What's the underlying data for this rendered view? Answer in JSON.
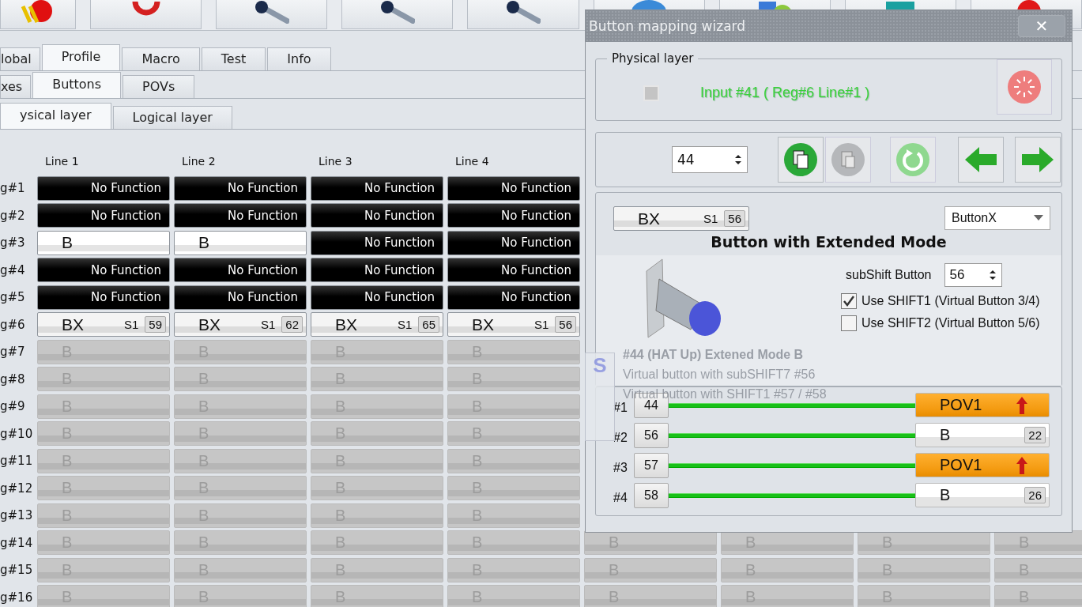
{
  "main_tabs": [
    {
      "label": "lobal",
      "selected": false
    },
    {
      "label": "Profile",
      "selected": true
    },
    {
      "label": "Macro",
      "selected": false
    },
    {
      "label": "Test",
      "selected": false
    },
    {
      "label": "Info",
      "selected": false
    }
  ],
  "sub_tabs": [
    {
      "label": "xes",
      "selected": false
    },
    {
      "label": "Buttons",
      "selected": true
    },
    {
      "label": "POVs",
      "selected": false
    }
  ],
  "layer_tabs": [
    {
      "label": "ysical layer",
      "selected": true
    },
    {
      "label": "Logical layer",
      "selected": false
    }
  ],
  "grid": {
    "columns": [
      "Line 1",
      "Line 2",
      "Line 3",
      "Line 4"
    ],
    "rows": [
      {
        "label": "g#1",
        "cells": [
          {
            "kind": "none",
            "text": "No Function"
          },
          {
            "kind": "none",
            "text": "No Function"
          },
          {
            "kind": "none",
            "text": "No Function"
          },
          {
            "kind": "none",
            "text": "No Function"
          }
        ]
      },
      {
        "label": "g#2",
        "cells": [
          {
            "kind": "none",
            "text": "No Function"
          },
          {
            "kind": "none",
            "text": "No Function"
          },
          {
            "kind": "none",
            "text": "No Function"
          },
          {
            "kind": "none",
            "text": "No Function"
          }
        ]
      },
      {
        "label": "g#3",
        "cells": [
          {
            "kind": "b",
            "text": "B"
          },
          {
            "kind": "b",
            "text": "B"
          },
          {
            "kind": "none",
            "text": "No Function"
          },
          {
            "kind": "none",
            "text": "No Function"
          }
        ]
      },
      {
        "label": "g#4",
        "cells": [
          {
            "kind": "none",
            "text": "No Function"
          },
          {
            "kind": "none",
            "text": "No Function"
          },
          {
            "kind": "none",
            "text": "No Function"
          },
          {
            "kind": "none",
            "text": "No Function"
          }
        ]
      },
      {
        "label": "g#5",
        "cells": [
          {
            "kind": "none",
            "text": "No Function"
          },
          {
            "kind": "none",
            "text": "No Function"
          },
          {
            "kind": "none",
            "text": "No Function"
          },
          {
            "kind": "none",
            "text": "No Function"
          }
        ]
      },
      {
        "label": "g#6",
        "cells": [
          {
            "kind": "bx",
            "text": "BX",
            "shift": "S1",
            "number": "59"
          },
          {
            "kind": "bx",
            "text": "BX",
            "shift": "S1",
            "number": "62"
          },
          {
            "kind": "bx",
            "text": "BX",
            "shift": "S1",
            "number": "65"
          },
          {
            "kind": "bx",
            "text": "BX",
            "shift": "S1",
            "number": "56"
          }
        ]
      },
      {
        "label": "g#7",
        "cells": [
          {
            "kind": "disabled",
            "text": "B"
          },
          {
            "kind": "disabled",
            "text": "B"
          },
          {
            "kind": "disabled",
            "text": "B"
          },
          {
            "kind": "disabled",
            "text": "B"
          }
        ]
      },
      {
        "label": "g#8",
        "cells": [
          {
            "kind": "disabled",
            "text": "B"
          },
          {
            "kind": "disabled",
            "text": "B"
          },
          {
            "kind": "disabled",
            "text": "B"
          },
          {
            "kind": "disabled",
            "text": "B"
          }
        ]
      },
      {
        "label": "g#9",
        "cells": [
          {
            "kind": "disabled",
            "text": "B"
          },
          {
            "kind": "disabled",
            "text": "B"
          },
          {
            "kind": "disabled",
            "text": "B"
          },
          {
            "kind": "disabled",
            "text": "B"
          }
        ]
      },
      {
        "label": "g#10",
        "cells": [
          {
            "kind": "disabled",
            "text": "B"
          },
          {
            "kind": "disabled",
            "text": "B"
          },
          {
            "kind": "disabled",
            "text": "B"
          },
          {
            "kind": "disabled",
            "text": "B"
          }
        ]
      },
      {
        "label": "g#11",
        "cells": [
          {
            "kind": "disabled",
            "text": "B"
          },
          {
            "kind": "disabled",
            "text": "B"
          },
          {
            "kind": "disabled",
            "text": "B"
          },
          {
            "kind": "disabled",
            "text": "B"
          }
        ]
      },
      {
        "label": "g#12",
        "cells": [
          {
            "kind": "disabled",
            "text": "B"
          },
          {
            "kind": "disabled",
            "text": "B"
          },
          {
            "kind": "disabled",
            "text": "B"
          },
          {
            "kind": "disabled",
            "text": "B"
          }
        ]
      },
      {
        "label": "g#13",
        "cells": [
          {
            "kind": "disabled",
            "text": "B"
          },
          {
            "kind": "disabled",
            "text": "B"
          },
          {
            "kind": "disabled",
            "text": "B"
          },
          {
            "kind": "disabled",
            "text": "B"
          }
        ]
      },
      {
        "label": "g#14",
        "cells": [
          {
            "kind": "disabled",
            "text": "B"
          },
          {
            "kind": "disabled",
            "text": "B"
          },
          {
            "kind": "disabled",
            "text": "B"
          },
          {
            "kind": "disabled",
            "text": "B"
          },
          {
            "kind": "disabled",
            "text": "B"
          },
          {
            "kind": "disabled",
            "text": "B"
          },
          {
            "kind": "disabled",
            "text": "B"
          },
          {
            "kind": "disabled",
            "text": "B"
          }
        ]
      },
      {
        "label": "g#15",
        "cells": [
          {
            "kind": "disabled",
            "text": "B"
          },
          {
            "kind": "disabled",
            "text": "B"
          },
          {
            "kind": "disabled",
            "text": "B"
          },
          {
            "kind": "disabled",
            "text": "B"
          },
          {
            "kind": "disabled",
            "text": "B"
          },
          {
            "kind": "disabled",
            "text": "B"
          },
          {
            "kind": "disabled",
            "text": "B"
          },
          {
            "kind": "disabled",
            "text": "B"
          }
        ]
      },
      {
        "label": "g#16",
        "cells": [
          {
            "kind": "disabled",
            "text": "B"
          },
          {
            "kind": "disabled",
            "text": "B"
          },
          {
            "kind": "disabled",
            "text": "B"
          },
          {
            "kind": "disabled",
            "text": "B"
          },
          {
            "kind": "disabled",
            "text": "B"
          },
          {
            "kind": "disabled",
            "text": "B"
          },
          {
            "kind": "disabled",
            "text": "B"
          },
          {
            "kind": "disabled",
            "text": "B"
          }
        ]
      }
    ]
  },
  "dialog": {
    "title": "Button mapping wizard",
    "close": "✕",
    "physical_layer": {
      "legend": "Physical layer",
      "active": false,
      "input": "Input #41  ( Reg#6  Line#1 )"
    },
    "navigator": {
      "value": "44"
    },
    "mode": {
      "cell": {
        "kind": "bx",
        "text": "BX",
        "shift": "S1",
        "number": "56"
      },
      "dropdown": "ButtonX",
      "title": "Button  with Extended Mode",
      "subshift_label": "subShift Button",
      "subshift_value": "56",
      "options": [
        {
          "label": "Use SHIFT1 (Virtual Button 3/4)",
          "checked": true
        },
        {
          "label": "Use SHIFT2 (Virtual Button 5/6)",
          "checked": false
        }
      ]
    },
    "mappings": [
      {
        "index": "#1",
        "number": "44",
        "target": {
          "kind": "pov",
          "text": "POV1"
        }
      },
      {
        "index": "#2",
        "number": "56",
        "target": {
          "kind": "b",
          "text": "B",
          "number": "22"
        }
      },
      {
        "index": "#3",
        "number": "57",
        "target": {
          "kind": "pov",
          "text": "POV1"
        }
      },
      {
        "index": "#4",
        "number": "58",
        "target": {
          "kind": "b",
          "text": "B",
          "number": "26"
        }
      }
    ]
  },
  "tooltip": {
    "badge": "S",
    "title": "#44 (HAT Up) Extened Mode B",
    "lines": [
      "Virtual button with subSHIFT7  #56",
      "Virtual button with SHIFT1  #57 / #58"
    ]
  }
}
